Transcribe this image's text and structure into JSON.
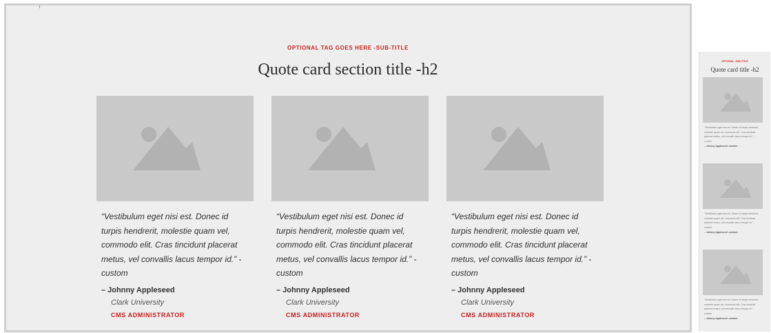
{
  "desktop": {
    "tag": "OPTIONAL TAG GOES HERE -SUB-TITLE",
    "title": "Quote card section title -h2",
    "cards": [
      {
        "quote": "“Vestibulum eget nisi est. Donec id turpis hendrerit, molestie quam vel, commodo elit. Cras tincidunt placerat metus, vel convallis lacus tempor id.” -custom",
        "author": "– Johnny Appleseed",
        "org": "Clark University",
        "role": "CMS ADMINISTRATOR"
      },
      {
        "quote": "“Vestibulum eget nisi est. Donec id turpis hendrerit, molestie quam vel, commodo elit. Cras tincidunt placerat metus, vel convallis lacus tempor id.” -custom",
        "author": "– Johnny Appleseed",
        "org": "Clark University",
        "role": "CMS ADMINISTRATOR"
      },
      {
        "quote": "“Vestibulum eget nisi est. Donec id turpis hendrerit, molestie quam vel, commodo elit. Cras tincidunt placerat metus, vel convallis lacus tempor id.” -custom",
        "author": "– Johnny Appleseed",
        "org": "Clark University",
        "role": "CMS ADMINISTRATOR"
      }
    ]
  },
  "mobile": {
    "tag": "OPTIONAL -SUB-TITLE",
    "title": "Quote card title -h2",
    "cards": [
      {
        "quote": "“Vestibulum eget nisi est. Donec id turpis hendrerit, molestie quam vel, commodo elit. Cras tincidunt placerat metus, vel convallis lacus tempor id.” -custom",
        "author": "– Johnny Appleseed -custom"
      },
      {
        "quote": "“Vestibulum eget nisi est. Donec id turpis hendrerit, molestie quam vel, commodo elit. Cras tincidunt placerat metus, vel convallis lacus tempor id.” -custom",
        "author": "– Johnny Appleseed -custom"
      },
      {
        "quote": "“Vestibulum eget nisi est. Donec id turpis hendrerit, molestie quam vel, commodo elit. Cras tincidunt placerat metus, vel convallis lacus tempor id.” -custom",
        "author": "– Johnny Appleseed -custom"
      }
    ]
  },
  "colors": {
    "accent": "#cc1f1f",
    "placeholder": "#c9c9c9",
    "placeholder_shape": "#b2b2b2"
  },
  "icons": {
    "card_image": "image-placeholder-icon"
  }
}
